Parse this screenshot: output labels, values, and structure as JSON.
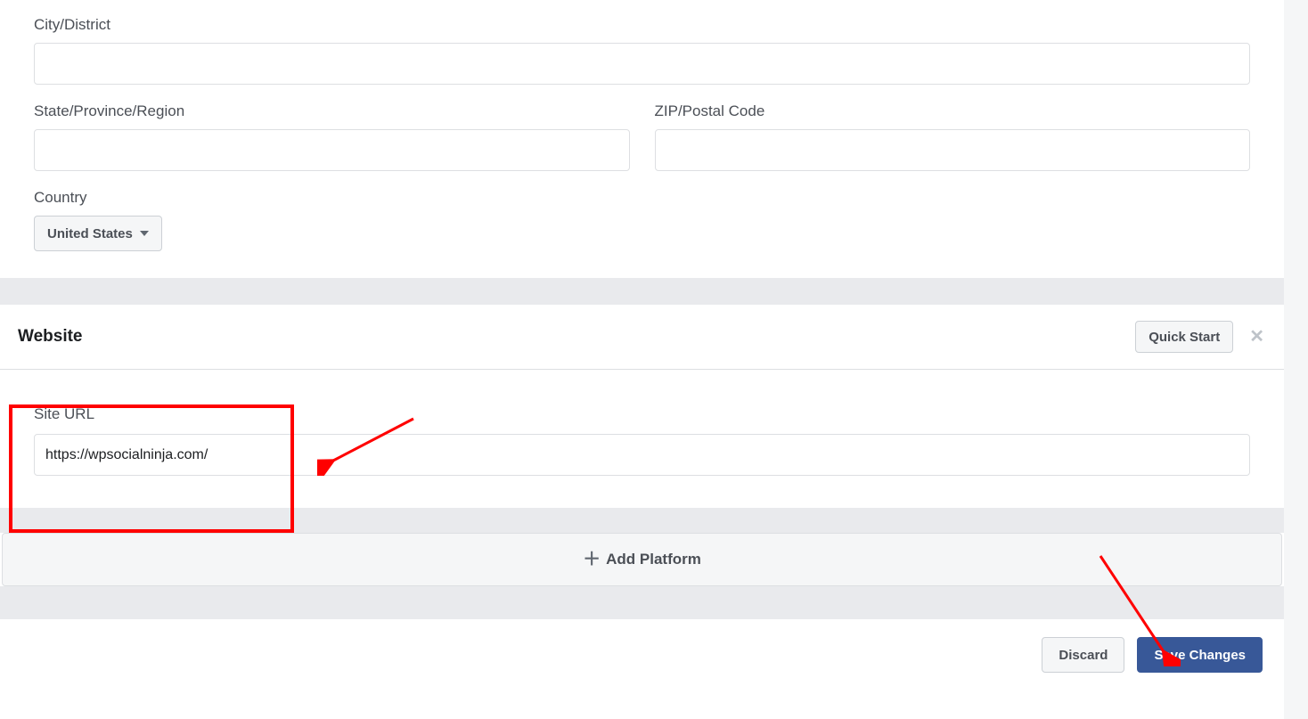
{
  "address": {
    "city_label": "City/District",
    "city_value": "",
    "state_label": "State/Province/Region",
    "state_value": "",
    "zip_label": "ZIP/Postal Code",
    "zip_value": "",
    "country_label": "Country",
    "country_value": "United States"
  },
  "website": {
    "section_title": "Website",
    "quick_start_label": "Quick Start",
    "site_url_label": "Site URL",
    "site_url_value": "https://wpsocialninja.com/"
  },
  "add_platform_label": "Add Platform",
  "footer": {
    "discard_label": "Discard",
    "save_label": "Save Changes"
  }
}
